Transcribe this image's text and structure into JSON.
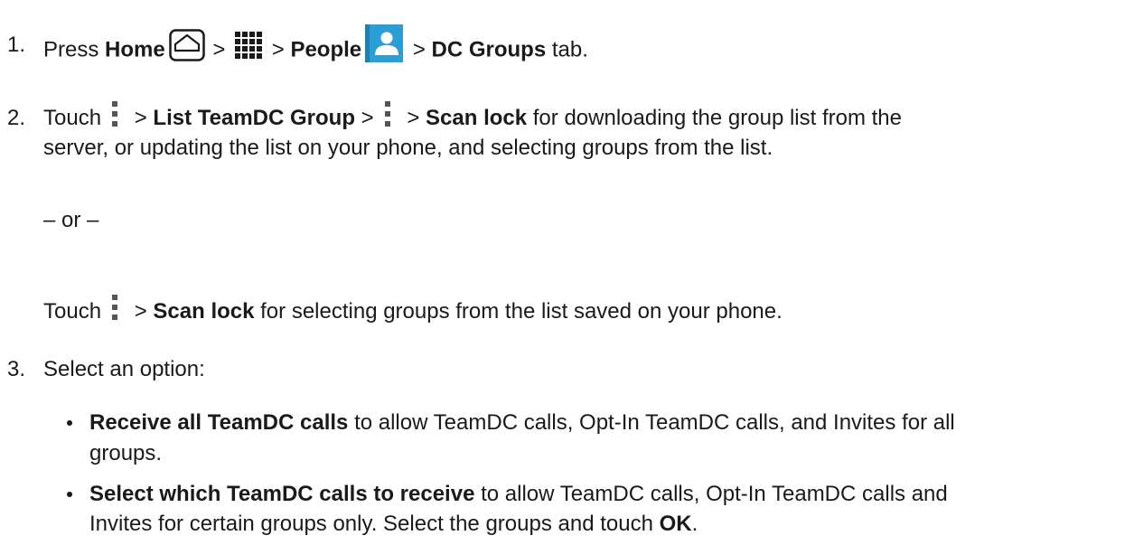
{
  "step1": {
    "number": "1.",
    "press": "Press",
    "home": "Home",
    "sep1": ">",
    "sep2": ">",
    "people": "People",
    "sep3": ">",
    "dc_groups": "DC Groups",
    "tab": "tab."
  },
  "step2": {
    "number": "2.",
    "touch": "Touch",
    "sep1": ">",
    "list_group": "List TeamDC Group",
    "sep2": ">",
    "sep3": ">",
    "scan_lock": "Scan lock",
    "rest_line1": "for downloading the group list from the",
    "line2": "server, or updating the list on your phone, and selecting groups from the list.",
    "or": "– or –",
    "alt_touch": "Touch",
    "alt_sep": ">",
    "alt_scan_lock": "Scan lock",
    "alt_rest": "for selecting groups from the list saved on your phone."
  },
  "step3": {
    "number": "3.",
    "text": "Select an option:",
    "bullets": [
      {
        "bold": "Receive all TeamDC calls",
        "rest_line1": "to allow TeamDC calls, Opt-In TeamDC calls, and Invites for all",
        "line2": "groups."
      },
      {
        "bold": "Select which TeamDC calls to receive",
        "rest_line1": "to allow TeamDC calls, Opt-In TeamDC calls and",
        "line2_pre": "Invites for certain groups only. Select the groups and touch",
        "line2_bold": "OK",
        "line2_post": "."
      }
    ]
  },
  "icons": {
    "home": "home-icon",
    "apps": "apps-grid-icon",
    "people": "people-contacts-icon",
    "menu": "menu-vertical-dots-icon",
    "people_color": "#2a9fd6"
  }
}
